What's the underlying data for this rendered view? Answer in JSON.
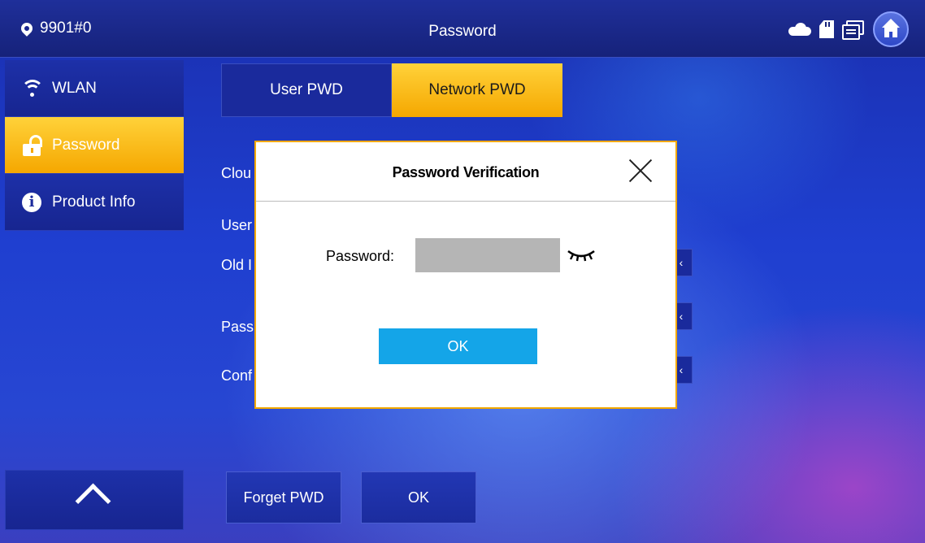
{
  "topbar": {
    "room": "9901#0",
    "title": "Password"
  },
  "sidebar": {
    "items": [
      {
        "label": "WLAN",
        "icon": "wifi-icon"
      },
      {
        "label": "Password",
        "icon": "lock-icon"
      },
      {
        "label": "Product Info",
        "icon": "info-icon"
      }
    ]
  },
  "tabs": [
    {
      "label": "User PWD"
    },
    {
      "label": "Network PWD"
    }
  ],
  "form": {
    "labels": [
      "Clou",
      "User",
      "Old I",
      "Pass",
      "Conf"
    ],
    "field_glyph": "‹"
  },
  "bottom": {
    "forget_label": "Forget PWD",
    "ok_label": "OK"
  },
  "modal": {
    "title": "Password Verification",
    "password_label": "Password:",
    "password_value": "",
    "ok_label": "OK"
  },
  "colors": {
    "accent": "#f5a700",
    "ok_button": "#14a5e8",
    "modal_border": "#f2a800"
  }
}
